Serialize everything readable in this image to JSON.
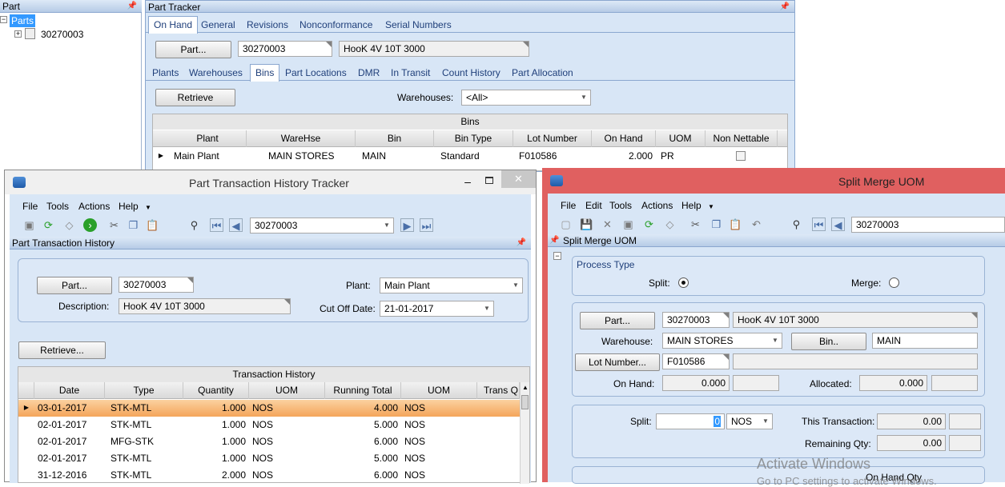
{
  "left_tree": {
    "title": "Part",
    "root_label": "Parts",
    "child_label": "30270003"
  },
  "part_tracker": {
    "title": "Part Tracker",
    "tabs": [
      "On Hand",
      "General",
      "Revisions",
      "Nonconformance",
      "Serial Numbers"
    ],
    "part_button": "Part...",
    "part_value": "30270003",
    "description_value": "HooK 4V 10T 3000",
    "subtabs": [
      "Plants",
      "Warehouses",
      "Bins",
      "Part Locations",
      "DMR",
      "In Transit",
      "Count History",
      "Part Allocation"
    ],
    "retrieve_button": "Retrieve",
    "warehouses_label": "Warehouses:",
    "warehouses_value": "<All>",
    "bins_grid_title": "Bins",
    "bins_columns": [
      "Plant",
      "WareHse",
      "Bin",
      "Bin Type",
      "Lot Number",
      "On Hand",
      "UOM",
      "Non Nettable"
    ],
    "bins_row": {
      "plant": "Main Plant",
      "warehouse": "MAIN STORES",
      "bin": "MAIN",
      "bin_type": "Standard",
      "lot": "F010586",
      "on_hand": "2.000",
      "uom": "PR"
    }
  },
  "pth": {
    "window_title": "Part Transaction History Tracker",
    "menu": [
      "File",
      "Tools",
      "Actions",
      "Help"
    ],
    "toolbar_combo": "30270003",
    "panel_title": "Part Transaction History",
    "part_button": "Part...",
    "part_value": "30270003",
    "plant_label": "Plant:",
    "plant_value": "Main Plant",
    "description_label": "Description:",
    "description_value": "HooK 4V 10T 3000",
    "cutoff_label": "Cut Off Date:",
    "cutoff_value": "21-01-2017",
    "retrieve_button": "Retrieve...",
    "grid_title": "Transaction History",
    "columns": [
      "Date",
      "Type",
      "Quantity",
      "UOM",
      "Running Total",
      "UOM",
      "Trans Q"
    ],
    "rows": [
      {
        "date": "03-01-2017",
        "type": "STK-MTL",
        "qty": "1.000",
        "uom": "NOS",
        "total": "4.000",
        "uom2": "NOS"
      },
      {
        "date": "02-01-2017",
        "type": "STK-MTL",
        "qty": "1.000",
        "uom": "NOS",
        "total": "5.000",
        "uom2": "NOS"
      },
      {
        "date": "02-01-2017",
        "type": "MFG-STK",
        "qty": "1.000",
        "uom": "NOS",
        "total": "6.000",
        "uom2": "NOS"
      },
      {
        "date": "02-01-2017",
        "type": "STK-MTL",
        "qty": "1.000",
        "uom": "NOS",
        "total": "5.000",
        "uom2": "NOS"
      },
      {
        "date": "31-12-2016",
        "type": "STK-MTL",
        "qty": "2.000",
        "uom": "NOS",
        "total": "6.000",
        "uom2": "NOS"
      }
    ]
  },
  "smu": {
    "window_title": "Split Merge UOM",
    "menu": [
      "File",
      "Edit",
      "Tools",
      "Actions",
      "Help"
    ],
    "toolbar_combo": "30270003",
    "panel_title": "Split Merge UOM",
    "process_type_label": "Process Type",
    "split_label": "Split:",
    "merge_label": "Merge:",
    "part_button": "Part...",
    "part_value": "30270003",
    "description_value": "HooK 4V 10T 3000",
    "warehouse_label": "Warehouse:",
    "warehouse_value": "MAIN STORES",
    "bin_button": "Bin..",
    "bin_value": "MAIN",
    "lot_button": "Lot Number...",
    "lot_value": "F010586",
    "onhand_label": "On Hand:",
    "onhand_value": "0.000",
    "allocated_label": "Allocated:",
    "allocated_value": "0.000",
    "split_qty_label": "Split:",
    "split_qty_value": "0",
    "split_uom": "NOS",
    "this_transaction_label": "This Transaction:",
    "this_transaction_value": "0.00",
    "remaining_label": "Remaining Qty:",
    "remaining_value": "0.00",
    "onhand_qty_label": "On Hand Qty"
  },
  "watermark": {
    "line1": "Activate Windows",
    "line2": "Go to PC settings to activate Windows."
  },
  "colors": {
    "accent_blue": "#d8e6f6",
    "titlebar_red": "#e06060",
    "selected_row": "#f7b46a"
  }
}
